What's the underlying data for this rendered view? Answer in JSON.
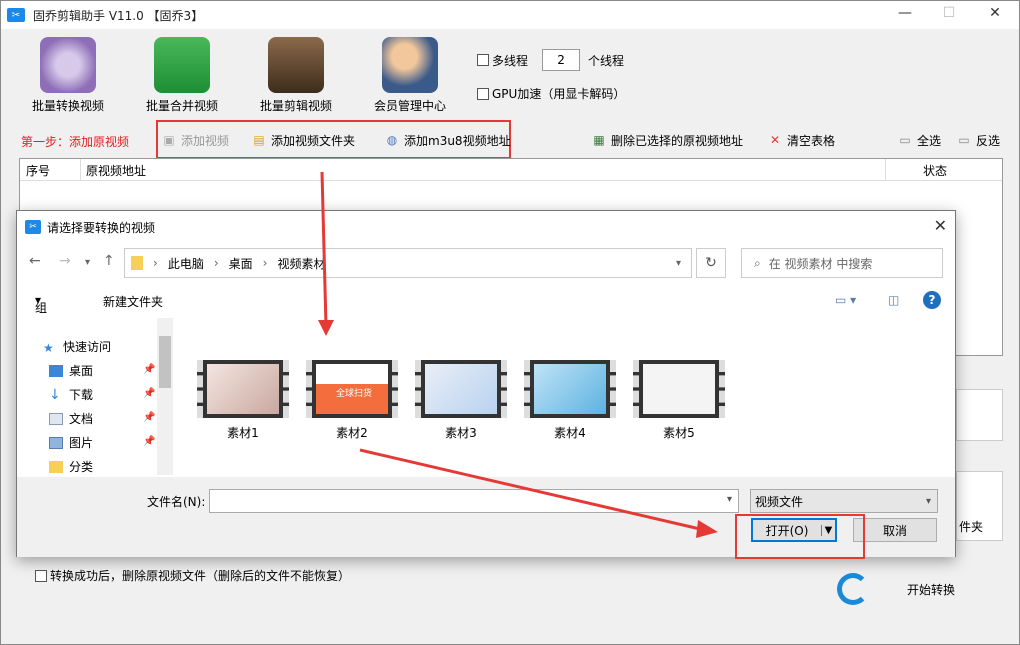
{
  "app": {
    "title": "固乔剪辑助手 V11.0 【固乔3】",
    "win_min": "—",
    "win_max": "☐",
    "win_close": "✕"
  },
  "toolbar": {
    "batch_convert": "批量转换视频",
    "batch_merge": "批量合并视频",
    "batch_clip": "批量剪辑视频",
    "member_center": "会员管理中心"
  },
  "options": {
    "multithread_label": "多线程",
    "thread_count": "2",
    "thread_unit": "个线程",
    "gpu_label": "GPU加速（用显卡解码）"
  },
  "step": {
    "label": "第一步：添加原视频",
    "add_video": "添加视频",
    "add_folder": "添加视频文件夹",
    "add_m3u8": "添加m3u8视频地址",
    "delete_selected": "删除已选择的原视频地址",
    "clear_table": "清空表格",
    "select_all": "全选",
    "invert": "反选"
  },
  "grid": {
    "col_index": "序号",
    "col_path": "原视频地址",
    "col_status": "状态"
  },
  "side_text": "件夹",
  "bottom": {
    "delete_after_label": "转换成功后，删除原视频文件（删除后的文件不能恢复）",
    "start_label": "开始转换"
  },
  "dialog": {
    "title": "请选择要转换的视频",
    "breadcrumb": [
      "此电脑",
      "桌面",
      "视频素材"
    ],
    "search_placeholder": "在 视频素材 中搜索",
    "organize": "组织",
    "new_folder": "新建文件夹",
    "nav_items": [
      {
        "label": "快速访问"
      },
      {
        "label": "桌面"
      },
      {
        "label": "下载"
      },
      {
        "label": "文档"
      },
      {
        "label": "图片"
      },
      {
        "label": "分类"
      }
    ],
    "files": [
      "素材1",
      "素材2",
      "素材3",
      "素材4",
      "素材5"
    ],
    "thumb2_text": "全球扫货",
    "filename_label": "文件名(N):",
    "filetype": "视频文件",
    "open": "打开(O)",
    "cancel": "取消"
  },
  "colors": {
    "accent": "#0078d7",
    "highlight": "#e53935",
    "step_red": "#e02020"
  }
}
